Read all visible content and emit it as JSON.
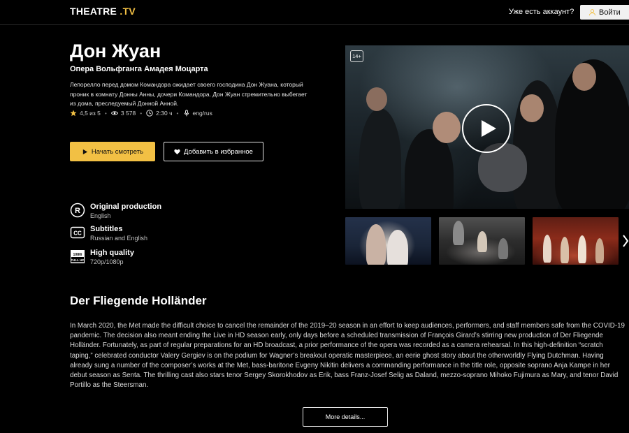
{
  "header": {
    "logo_main": "THEATRE",
    "logo_accent": ".TV",
    "have_account": "Уже есть аккаунт?",
    "login_label": "Войти"
  },
  "show": {
    "title": "Дон Жуан",
    "subtitle": "Опера Вольфганга Амадея Моцарта",
    "description": "Лепорелло перед домом Командора ожидает своего господина Дон Жуана, который проник в комнату Донны Анны, дочери Командора. Дон Жуан стремительно выбегает из дома, преследуемый Донной Анной.",
    "meta": {
      "rating": "4,5 из 5",
      "views": "3 578",
      "duration": "2:30 ч",
      "audio": "eng/rus"
    },
    "watch_label": "Начать смотреть",
    "favorite_label": "Добавить в избранное",
    "age_rating": "14+"
  },
  "features": [
    {
      "icon": "r-circle-icon",
      "title": "Original production",
      "sub": "English"
    },
    {
      "icon": "cc-icon",
      "title": "Subtitles",
      "sub": "Russian and English"
    },
    {
      "icon": "hd-icon",
      "title": "High quality",
      "sub": "720p/1080p",
      "badge_top": "1080i",
      "badge_bottom": "FULL HD"
    }
  ],
  "section": {
    "title": "Der Fliegende Holländer",
    "text": "In March 2020, the Met made the difficult choice to cancel the remainder of the 2019–20 season in an effort to keep audiences, performers, and staff members safe from the COVID-19 pandemic. The decision also meant ending the Live in HD season early, only days before a scheduled transmission of François Girard’s stirring new production of Der Fliegende Holländer. Fortunately, as part of regular preparations for an HD broadcast, a prior performance of the opera was recorded as a camera rehearsal. In this high-definition “scratch taping,” celebrated conductor Valery Gergiev is on the podium for Wagner’s breakout operatic masterpiece, an eerie ghost story about the otherworldly Flying Dutchman. Having already sung a number of the composer’s works at the Met, bass-baritone Evgeny Nikitin delivers a commanding performance in the title role, opposite soprano Anja Kampe in her debut season as Senta. The thrilling cast also stars tenor Sergey Skorokhodov as Erik, bass Franz-Josef Selig as Daland, mezzo-soprano Mihoko Fujimura as Mary, and tenor David Portillo as the Steersman.",
    "more_label": "More details..."
  },
  "colors": {
    "accent": "#f2c044",
    "background": "#000000"
  }
}
